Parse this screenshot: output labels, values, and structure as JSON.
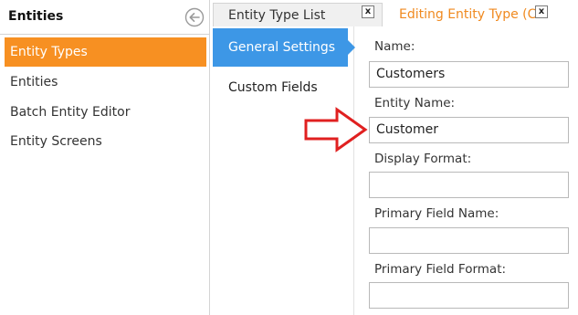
{
  "sidebar": {
    "title": "Entities",
    "back_icon": "circle-arrow-left-icon",
    "items": [
      {
        "label": "Entity Types",
        "active": true
      },
      {
        "label": "Entities",
        "active": false
      },
      {
        "label": "Batch Entity Editor",
        "active": false
      },
      {
        "label": "Entity Screens",
        "active": false
      }
    ]
  },
  "tabs": [
    {
      "label": "Entity Type List",
      "close": "x",
      "active": false
    },
    {
      "label": "Editing Entity Type (Cu",
      "close": "x",
      "active": true
    }
  ],
  "inner_nav": {
    "items": [
      {
        "label": "General Settings",
        "active": true
      },
      {
        "label": "Custom Fields",
        "active": false
      }
    ]
  },
  "form": {
    "name_label": "Name:",
    "name_value": "Customers",
    "entity_name_label": "Entity Name:",
    "entity_name_value": "Customer",
    "display_format_label": "Display Format:",
    "display_format_value": "",
    "primary_field_name_label": "Primary Field Name:",
    "primary_field_name_value": "",
    "primary_field_format_label": "Primary Field Format:",
    "primary_field_format_value": ""
  },
  "colors": {
    "sidebar_active": "#f79022",
    "tab_active_text": "#f08a20",
    "nav_active": "#3d97e6",
    "annotation_arrow": "#e02020"
  },
  "annotation": {
    "icon": "red-outline-arrow-right-icon"
  }
}
